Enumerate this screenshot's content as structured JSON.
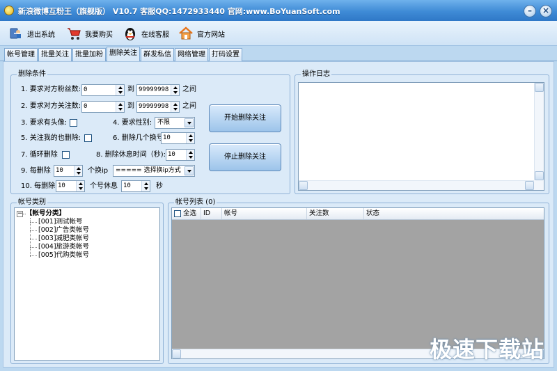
{
  "window": {
    "title": "新浪微博互粉王（旗舰版） V10.7 客服QQ:1472933440 官网:www.BoYuanSoft.com",
    "minimize": "–",
    "close": "×"
  },
  "toolbar": {
    "exit": "退出系统",
    "buy": "我要购买",
    "service": "在线客服",
    "website": "官方网站"
  },
  "tabs": [
    "帐号管理",
    "批量关注",
    "批量加粉",
    "删除关注",
    "群发私信",
    "网络管理",
    "打码设置"
  ],
  "active_tab": "删除关注",
  "conditions": {
    "title": "删除条件",
    "row1_label": "1. 要求对方粉丝数:",
    "row1_min": "0",
    "row1_to": "到",
    "row1_max": "99999998",
    "row1_suffix": "之间",
    "row2_label": "2. 要求对方关注数:",
    "row2_min": "0",
    "row2_to": "到",
    "row2_max": "99999998",
    "row2_suffix": "之间",
    "row3_label": "3. 要求有头像:",
    "row4_label": "4. 要求性别:",
    "gender": "不限",
    "row5_label": "5. 关注我的也删除:",
    "row6_label": "6. 删除几个换号:",
    "row6_value": "10",
    "row7_label": "7. 循环删除",
    "row8_label": "8. 删除休息时间（秒):",
    "row8_value": "10",
    "row9_label": "9. 每删除",
    "row9_value": "10",
    "row9_mid": "个换ip",
    "ip_method": "===== 选择换ip方式",
    "row10_label": "10. 每删除",
    "row10_value": "10",
    "row10_mid": "个号休息",
    "row10_value2": "10",
    "row10_suffix": "秒",
    "start_button": "开始删除关注",
    "stop_button": "停止删除关注"
  },
  "log": {
    "title": "操作日志"
  },
  "account_category": {
    "title": "帐号类别",
    "root": "【帐号分类】",
    "items": [
      "[001]测试帐号",
      "[002]广告类帐号",
      "[003]减肥类帐号",
      "[004]旅游类帐号",
      "[005]代购类帐号"
    ]
  },
  "account_list": {
    "title": "帐号列表 (0)",
    "columns": [
      "全选",
      "ID",
      "帐号",
      "关注数",
      "状态"
    ]
  },
  "watermark": "极速下载站"
}
